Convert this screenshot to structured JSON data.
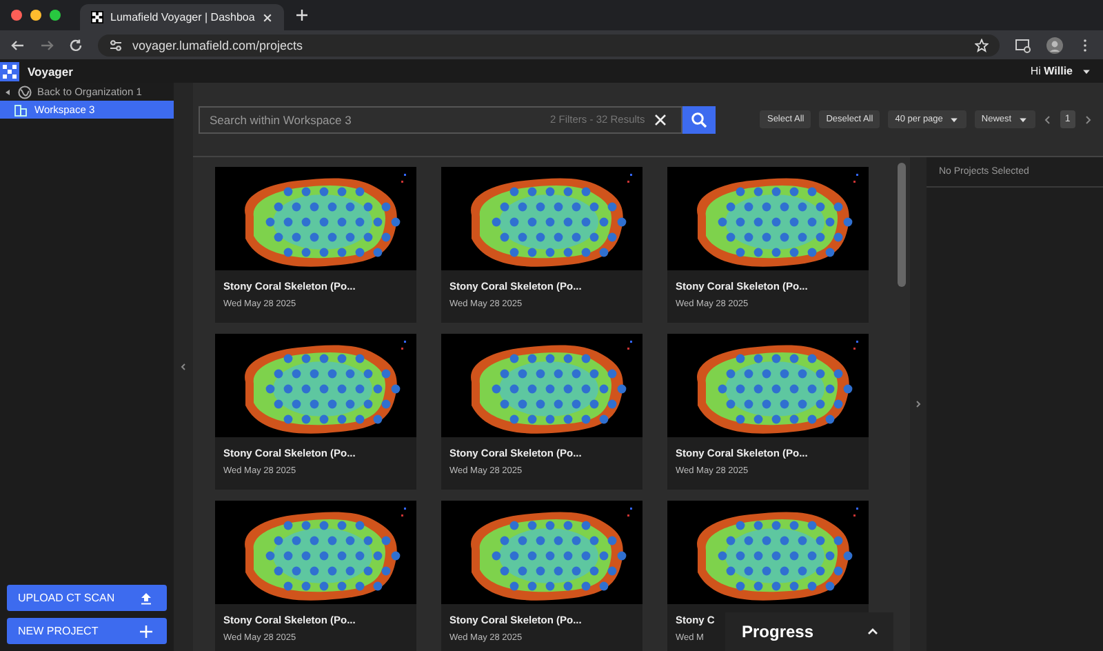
{
  "browser": {
    "tab_title": "Lumafield Voyager | Dashboa",
    "url": "voyager.lumafield.com/projects"
  },
  "header": {
    "brand": "Voyager",
    "greeting": "Hi **Willie**"
  },
  "sidebar": {
    "back_link": "Back to Organization 1",
    "items": [
      {
        "label": "Workspace 3",
        "selected": true
      }
    ],
    "buttons": [
      {
        "label": "UPLOAD CT SCAN",
        "kind": "upload"
      },
      {
        "label": "NEW PROJECT",
        "kind": "add"
      }
    ]
  },
  "search": {
    "placeholder": "Search within Workspace 3",
    "summary": "2 Filters - 32 Results"
  },
  "toolbar": {
    "buttons": [
      "Select All",
      "Deselect All"
    ],
    "per_page": "40 per page",
    "sort": "Newest",
    "page": "1"
  },
  "projects": [
    {
      "title": "Stony Coral Skeleton (Po...",
      "date": "Wed May 28 2025"
    },
    {
      "title": "Stony Coral Skeleton (Po...",
      "date": "Wed May 28 2025"
    },
    {
      "title": "Stony Coral Skeleton (Po...",
      "date": "Wed May 28 2025"
    },
    {
      "title": "Stony Coral Skeleton (Po...",
      "date": "Wed May 28 2025"
    },
    {
      "title": "Stony Coral Skeleton (Po...",
      "date": "Wed May 28 2025"
    },
    {
      "title": "Stony Coral Skeleton (Po...",
      "date": "Wed May 28 2025"
    },
    {
      "title": "Stony Coral Skeleton (Po...",
      "date": "Wed May 28 2025"
    },
    {
      "title": "Stony Coral Skeleton (Po...",
      "date": "Wed May 28 2025"
    },
    {
      "title": "Stony C",
      "date": "Wed M"
    }
  ],
  "selection_panel": {
    "message": "No Projects Selected"
  },
  "progress_panel": {
    "title": "Progress"
  }
}
